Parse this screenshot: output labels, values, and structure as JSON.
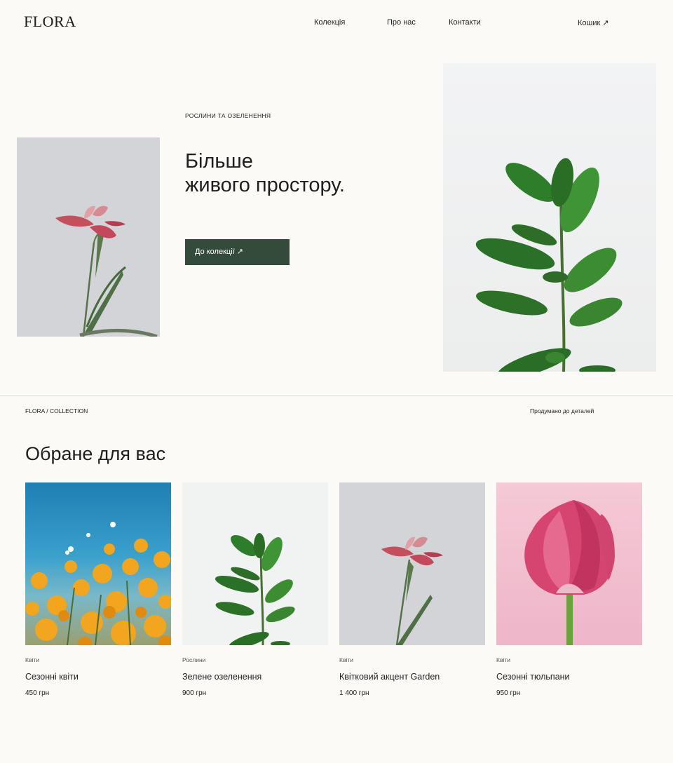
{
  "header": {
    "logo": "FLORA",
    "nav": [
      "Колекція",
      "Про нас",
      "Контакти"
    ],
    "cart": "Кошик ↗"
  },
  "hero": {
    "eyebrow": "РОСЛИНИ ТА ОЗЕЛЕНЕННЯ",
    "title_line1": "Більше",
    "title_line2": "живого простору.",
    "cta": "До колекції ↗"
  },
  "strip": {
    "breadcrumb": "FLORA / COLLECTION",
    "tagline": "Продумано до деталей"
  },
  "featured": {
    "title": "Обране для вас",
    "products": [
      {
        "category": "Квіти",
        "name": "Сезонні квіти",
        "price": "450 грн"
      },
      {
        "category": "Рослини",
        "name": "Зелене озеленення",
        "price": "900 грн"
      },
      {
        "category": "Квіти",
        "name": "Квітковий акцент Garden",
        "price": "1 400 грн"
      },
      {
        "category": "Квіти",
        "name": "Сезонні тюльпани",
        "price": "950 грн"
      }
    ]
  },
  "colors": {
    "background": "#fbfaf7",
    "button": "#344a3a",
    "text": "#222222"
  }
}
